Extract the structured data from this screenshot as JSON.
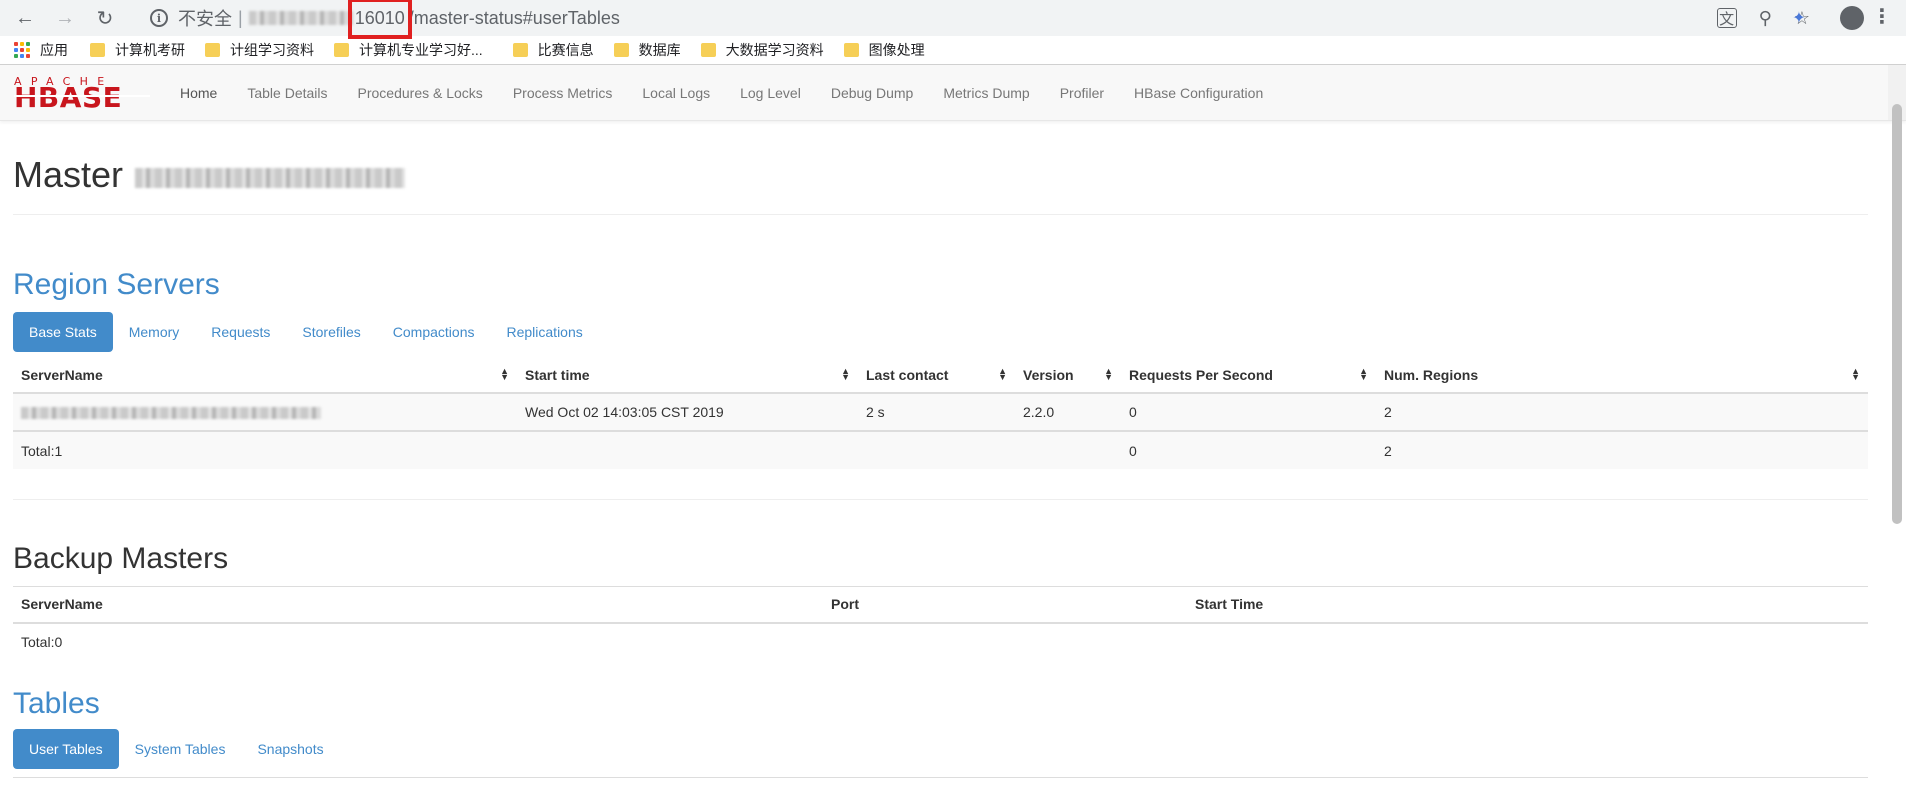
{
  "browser": {
    "security_label": "不安全",
    "url_port": "16010",
    "url_path": "/master-status#userTables",
    "bookmarks": [
      {
        "label": "应用",
        "icon": "apps-grid-icon"
      },
      {
        "label": "计算机考研",
        "icon": "folder-icon"
      },
      {
        "label": "计组学习资料",
        "icon": "folder-icon"
      },
      {
        "label": "计算机专业学习好...",
        "icon": "folder-icon"
      },
      {
        "label": "比赛信息",
        "icon": "folder-icon"
      },
      {
        "label": "数据库",
        "icon": "folder-icon"
      },
      {
        "label": "大数据学习资料",
        "icon": "folder-icon"
      },
      {
        "label": "图像处理",
        "icon": "folder-icon"
      }
    ]
  },
  "logo": {
    "top": "APACHE",
    "main": "HBASE"
  },
  "nav": {
    "items": [
      "Home",
      "Table Details",
      "Procedures & Locks",
      "Process Metrics",
      "Local Logs",
      "Log Level",
      "Debug Dump",
      "Metrics Dump",
      "Profiler",
      "HBase Configuration"
    ]
  },
  "page": {
    "title": "Master"
  },
  "region_servers": {
    "heading": "Region Servers",
    "tabs": [
      "Base Stats",
      "Memory",
      "Requests",
      "Storefiles",
      "Compactions",
      "Replications"
    ],
    "columns": [
      "ServerName",
      "Start time",
      "Last contact",
      "Version",
      "Requests Per Second",
      "Num. Regions"
    ],
    "rows": [
      {
        "start_time": "Wed Oct 02 14:03:05 CST 2019",
        "last_contact": "2 s",
        "version": "2.2.0",
        "rps": "0",
        "regions": "2"
      }
    ],
    "total": {
      "label": "Total:1",
      "rps": "0",
      "regions": "2"
    }
  },
  "backup_masters": {
    "heading": "Backup Masters",
    "columns": [
      "ServerName",
      "Port",
      "Start Time"
    ],
    "total": "Total:0"
  },
  "tables": {
    "heading": "Tables",
    "tabs": [
      "User Tables",
      "System Tables",
      "Snapshots"
    ]
  },
  "colors": {
    "accent": "#428bca",
    "brand_red": "#c8161d",
    "url_highlight": "#e02020"
  }
}
